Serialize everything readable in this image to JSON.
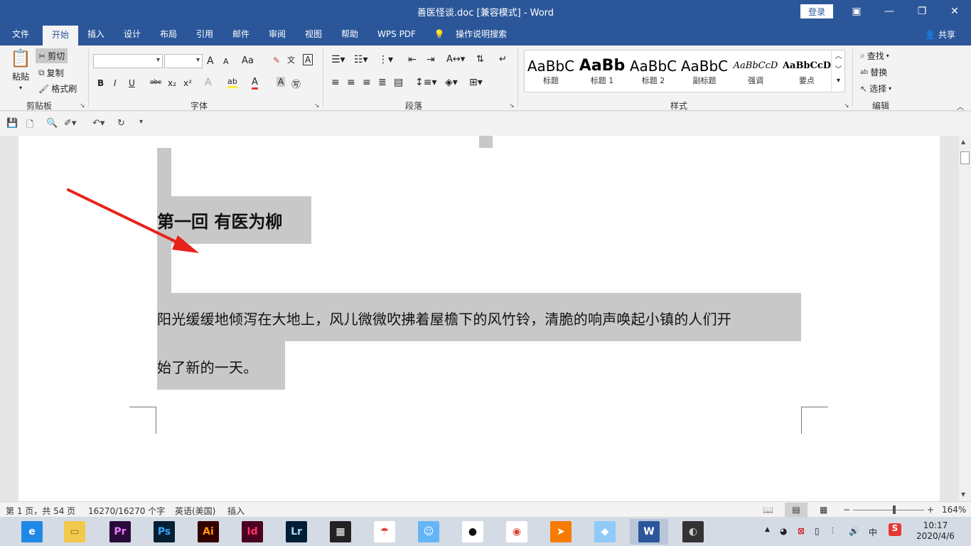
{
  "window": {
    "title": "善医怪谈.doc [兼容模式]  -  Word",
    "login_label": "登录",
    "minimize_glyph": "—",
    "restore_glyph": "❐",
    "close_glyph": "✕",
    "ribbon_display_glyph": "▣"
  },
  "tabs": [
    {
      "label": "文件"
    },
    {
      "label": "开始"
    },
    {
      "label": "插入"
    },
    {
      "label": "设计"
    },
    {
      "label": "布局"
    },
    {
      "label": "引用"
    },
    {
      "label": "邮件"
    },
    {
      "label": "审阅"
    },
    {
      "label": "视图"
    },
    {
      "label": "帮助"
    },
    {
      "label": "WPS PDF"
    },
    {
      "label": "操作说明搜索"
    }
  ],
  "share_label": "共享",
  "clipboard": {
    "paste": "粘贴",
    "cut": "剪切",
    "copy": "复制",
    "format_painter": "格式刷",
    "group_label": "剪贴板"
  },
  "font": {
    "group_label": "字体",
    "font_name_value": "",
    "font_size_value": "",
    "grow": "A",
    "shrink": "A",
    "change_case": "Aa",
    "bold": "B",
    "italic": "I",
    "underline": "U",
    "strike": "abc",
    "subscript": "x₂",
    "superscript": "x²"
  },
  "paragraph": {
    "group_label": "段落"
  },
  "styles": {
    "group_label": "样式",
    "items": [
      {
        "sample": "AaBbC",
        "name": "标题"
      },
      {
        "sample": "AaBb",
        "name": "标题 1"
      },
      {
        "sample": "AaBbC",
        "name": "标题 2"
      },
      {
        "sample": "AaBbC",
        "name": "副标题"
      },
      {
        "sample": "AaBbCcD",
        "name": "强调"
      },
      {
        "sample": "AaBbCcD",
        "name": "要点"
      }
    ]
  },
  "editing": {
    "find": "查找",
    "replace": "替换",
    "select": "选择",
    "group_label": "编辑"
  },
  "document": {
    "heading": "第一回  有医为柳",
    "para_line1": "阳光缓缓地倾泻在大地上，风儿微微吹拂着屋檐下的风竹铃，清脆的响声唤起小镇的人们开",
    "para_line2": "始了新的一天。"
  },
  "status": {
    "page": "第 1 页，共 54 页",
    "words": "16270/16270 个字",
    "language": "英语(美国)",
    "mode": "插入",
    "zoom": "164%",
    "zoom_minus": "−",
    "zoom_plus": "+"
  },
  "taskbar": {
    "apps": [
      {
        "name": "browser-360",
        "glyph": "e",
        "bg": "#1e88e5",
        "fg": "#ffffff"
      },
      {
        "name": "file-explorer",
        "glyph": "▭",
        "bg": "#f2c94c",
        "fg": "#8a6d1c"
      },
      {
        "name": "premiere",
        "glyph": "Pr",
        "bg": "#2a0a3a",
        "fg": "#e77bff"
      },
      {
        "name": "photoshop",
        "glyph": "Ps",
        "bg": "#061e33",
        "fg": "#31a8ff"
      },
      {
        "name": "illustrator",
        "glyph": "Ai",
        "bg": "#330000",
        "fg": "#ff9a00"
      },
      {
        "name": "indesign",
        "glyph": "Id",
        "bg": "#49021f",
        "fg": "#ff3366"
      },
      {
        "name": "lightroom",
        "glyph": "Lr",
        "bg": "#001e36",
        "fg": "#add5ec"
      },
      {
        "name": "video-editor",
        "glyph": "▦",
        "bg": "#222222",
        "fg": "#ffffff"
      },
      {
        "name": "umbrella-app",
        "glyph": "☂",
        "bg": "#ffffff",
        "fg": "#e53935"
      },
      {
        "name": "cat-app",
        "glyph": "☺",
        "bg": "#64b5f6",
        "fg": "#ffffff"
      },
      {
        "name": "qq",
        "glyph": "●",
        "bg": "#ffffff",
        "fg": "#111111"
      },
      {
        "name": "chrome",
        "glyph": "◉",
        "bg": "#ffffff",
        "fg": "#db4437"
      },
      {
        "name": "orange-app",
        "glyph": "➤",
        "bg": "#f57c00",
        "fg": "#ffffff"
      },
      {
        "name": "notes-app",
        "glyph": "◆",
        "bg": "#90caf9",
        "fg": "#ffffff"
      },
      {
        "name": "word",
        "glyph": "W",
        "bg": "#2b579a",
        "fg": "#ffffff"
      },
      {
        "name": "media-app",
        "glyph": "◐",
        "bg": "#333333",
        "fg": "#cccccc"
      }
    ],
    "active_app": "word",
    "ime": "中",
    "time": "10:17",
    "date": "2020/4/6"
  }
}
